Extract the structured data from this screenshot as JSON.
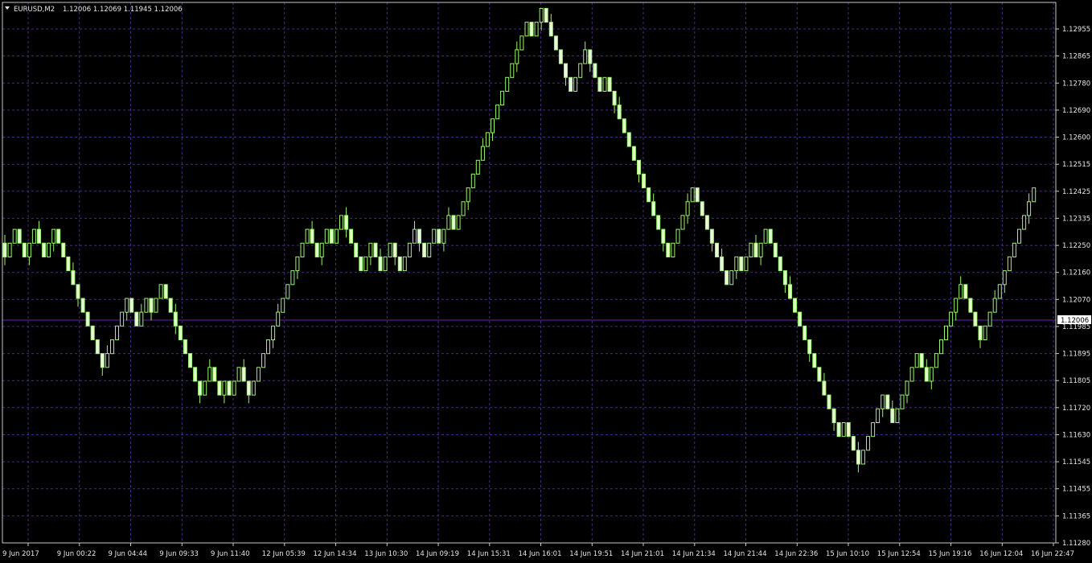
{
  "header": {
    "symbol": "EURUSD,M2",
    "ohlc": "1.12006 1.12069 1.11945 1.12006"
  },
  "colors": {
    "background": "#000000",
    "frame": "#c8c8c8",
    "grid": "#4b2a86",
    "bull_candle": "#9cf56b",
    "bear_candle": "#e6ffd2",
    "wick": "#9cf56b",
    "current_price_line": "#6a1fb0",
    "text": "#e6e6e6"
  },
  "chart_data": {
    "type": "candlestick",
    "symbol": "EURUSD",
    "timeframe": "M2",
    "grid": true,
    "current_price": "1.12006",
    "current_price_value": 1.12006,
    "ylim": [
      1.1128,
      1.1302
    ],
    "y_ticks": [
      "1.12955",
      "1.12865",
      "1.12780",
      "1.12690",
      "1.12600",
      "1.12515",
      "1.12425",
      "1.12335",
      "1.12250",
      "1.12160",
      "1.12070",
      "1.11985",
      "1.11895",
      "1.11805",
      "1.11720",
      "1.11630",
      "1.11545",
      "1.11455",
      "1.11365",
      "1.11280"
    ],
    "x_ticks": [
      "9 Jun 2017",
      "9 Jun 00:22",
      "9 Jun 04:44",
      "9 Jun 09:33",
      "9 Jun 11:40",
      "12 Jun 05:39",
      "12 Jun 14:34",
      "13 Jun 10:30",
      "14 Jun 09:19",
      "14 Jun 15:31",
      "14 Jun 16:01",
      "14 Jun 19:51",
      "14 Jun 21:01",
      "14 Jun 21:34",
      "14 Jun 21:44",
      "14 Jun 22:36",
      "15 Jun 10:10",
      "15 Jun 12:54",
      "15 Jun 19:16",
      "16 Jun 12:04",
      "16 Jun 22:47"
    ],
    "candle_width": 4,
    "candle_count": 216,
    "deltas": [
      -1,
      1,
      1,
      -1,
      -1,
      1,
      1,
      -1,
      -1,
      1,
      1,
      -1,
      -1,
      -1,
      -1,
      -1,
      -1,
      -1,
      -1,
      -1,
      -1,
      1,
      1,
      1,
      1,
      1,
      -1,
      -1,
      1,
      1,
      -1,
      1,
      1,
      -1,
      -1,
      -1,
      -1,
      -1,
      -1,
      -1,
      -1,
      1,
      1,
      -1,
      -1,
      1,
      -1,
      1,
      1,
      -1,
      -1,
      1,
      1,
      1,
      1,
      1,
      1,
      1,
      1,
      1,
      1,
      1,
      1,
      -1,
      -1,
      1,
      1,
      -1,
      1,
      1,
      -1,
      -1,
      -1,
      -1,
      1,
      1,
      -1,
      -1,
      1,
      1,
      -1,
      -1,
      1,
      1,
      1,
      -1,
      -1,
      1,
      1,
      -1,
      1,
      1,
      -1,
      1,
      1,
      1,
      1,
      1,
      1,
      1,
      1,
      1,
      1,
      1,
      1,
      1,
      1,
      1,
      -1,
      1,
      1,
      -1,
      -1,
      -1,
      -1,
      -1,
      -1,
      1,
      1,
      1,
      -1,
      -1,
      -1,
      1,
      -1,
      -1,
      -1,
      -1,
      -1,
      -1,
      -1,
      -1,
      -1,
      -1,
      -1,
      -1,
      -1,
      1,
      1,
      1,
      1,
      1,
      -1,
      -1,
      -1,
      -1,
      -1,
      -1,
      -1,
      1,
      1,
      -1,
      1,
      1,
      -1,
      1,
      1,
      -1,
      -1,
      -1,
      -1,
      -1,
      -1,
      -1,
      -1,
      -1,
      -1,
      -1,
      -1,
      -1,
      -1,
      -1,
      1,
      -1,
      -1,
      -1,
      1,
      1,
      1,
      1,
      1,
      -1,
      -1,
      1,
      1,
      1,
      1,
      1,
      -1,
      -1,
      1,
      1,
      1,
      1,
      1,
      1,
      1,
      -1,
      -1,
      -1,
      -1,
      1,
      1,
      1,
      1,
      1,
      1,
      1,
      1,
      1,
      1,
      1
    ],
    "start_price": 1.12257
  }
}
